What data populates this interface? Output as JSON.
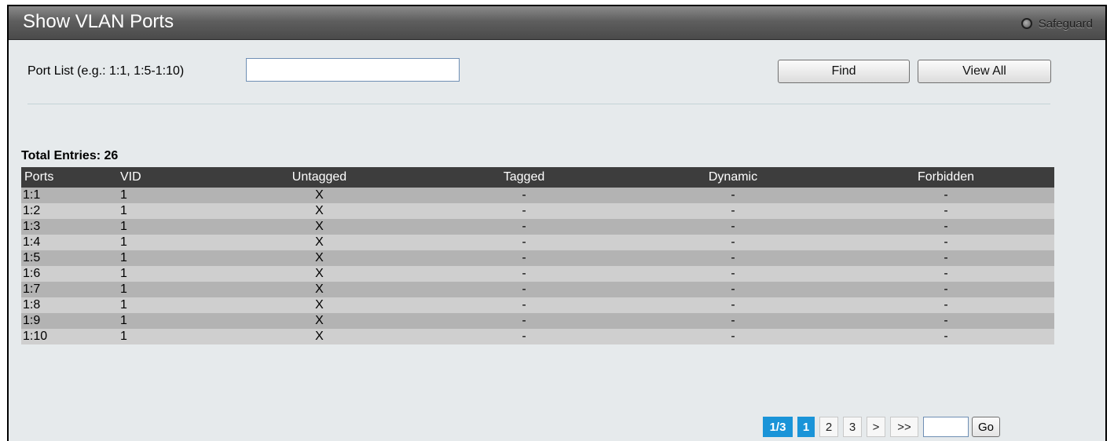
{
  "header": {
    "title": "Show VLAN Ports",
    "safeguard_label": "Safeguard"
  },
  "filter": {
    "port_list_label": "Port List (e.g.: 1:1, 1:5-1:10)",
    "port_list_value": "",
    "find_label": "Find",
    "view_all_label": "View All"
  },
  "table": {
    "total_entries_text": "Total Entries: 26",
    "columns": [
      "Ports",
      "VID",
      "Untagged",
      "Tagged",
      "Dynamic",
      "Forbidden"
    ],
    "rows": [
      [
        "1:1",
        "1",
        "X",
        "-",
        "-",
        "-"
      ],
      [
        "1:2",
        "1",
        "X",
        "-",
        "-",
        "-"
      ],
      [
        "1:3",
        "1",
        "X",
        "-",
        "-",
        "-"
      ],
      [
        "1:4",
        "1",
        "X",
        "-",
        "-",
        "-"
      ],
      [
        "1:5",
        "1",
        "X",
        "-",
        "-",
        "-"
      ],
      [
        "1:6",
        "1",
        "X",
        "-",
        "-",
        "-"
      ],
      [
        "1:7",
        "1",
        "X",
        "-",
        "-",
        "-"
      ],
      [
        "1:8",
        "1",
        "X",
        "-",
        "-",
        "-"
      ],
      [
        "1:9",
        "1",
        "X",
        "-",
        "-",
        "-"
      ],
      [
        "1:10",
        "1",
        "X",
        "-",
        "-",
        "-"
      ]
    ]
  },
  "pagination": {
    "page_info": "1/3",
    "pages": [
      "1",
      "2",
      "3"
    ],
    "current_page": "1",
    "next_label": ">",
    "last_label": ">>",
    "goto_value": "",
    "go_label": "Go"
  },
  "colors": {
    "title_bar": "#5e5e5e",
    "header_row": "#3d3d3d",
    "row_dark": "#b3b3b3",
    "row_light": "#cfcfcf",
    "page_active": "#1a94d8",
    "background": "#e6eaec"
  },
  "icons": {
    "safeguard": "safeguard-status-icon"
  }
}
